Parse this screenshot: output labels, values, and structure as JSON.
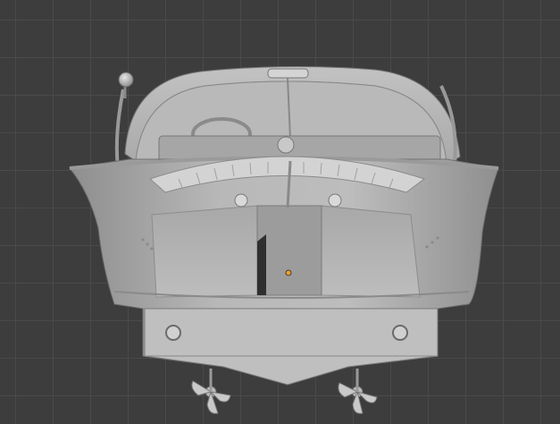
{
  "viewport": {
    "name": "3D Viewport",
    "background_color": "#3d3d3d",
    "grid_color": "#4a4a4a"
  },
  "model": {
    "name": "boat-front-view",
    "shading": "solid",
    "base_color": "#b3b3b3",
    "shadow_color": "#8d8d8d",
    "highlight_color": "#c6c6c6",
    "origin_color": "#f0a030"
  }
}
